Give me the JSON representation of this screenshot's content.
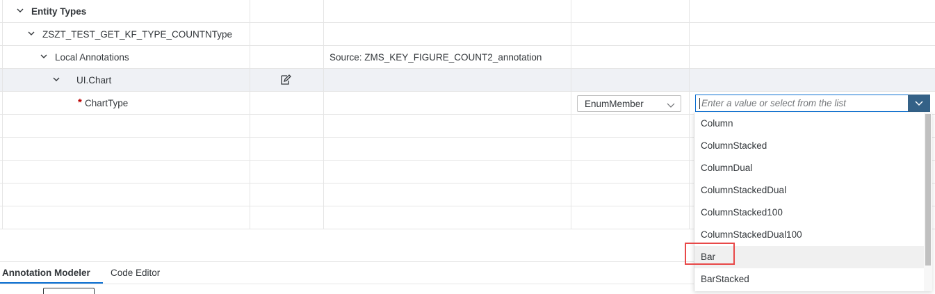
{
  "tree": {
    "entity_types": "Entity Types",
    "entity_name": "ZSZT_TEST_GET_KF_TYPE_COUNTNType",
    "local_annotations": "Local Annotations",
    "source": "Source: ZMS_KEY_FIGURE_COUNT2_annotation",
    "ui_chart": "UI.Chart",
    "required_marker": "*",
    "chart_type": "ChartType"
  },
  "type_select": {
    "value": "EnumMember"
  },
  "value_combo": {
    "placeholder": "Enter a value or select from the list"
  },
  "dropdown": {
    "options": [
      "Column",
      "ColumnStacked",
      "ColumnDual",
      "ColumnStackedDual",
      "ColumnStacked100",
      "ColumnStackedDual100",
      "Bar",
      "BarStacked"
    ],
    "highlighted": "Bar"
  },
  "tabs": [
    {
      "label": "Annotation Modeler",
      "active": true
    },
    {
      "label": "Code Editor",
      "active": false
    }
  ],
  "colors": {
    "accent": "#0a6ed1",
    "combo_button": "#346187",
    "required": "#bb0000",
    "highlight_box": "#e84848"
  }
}
